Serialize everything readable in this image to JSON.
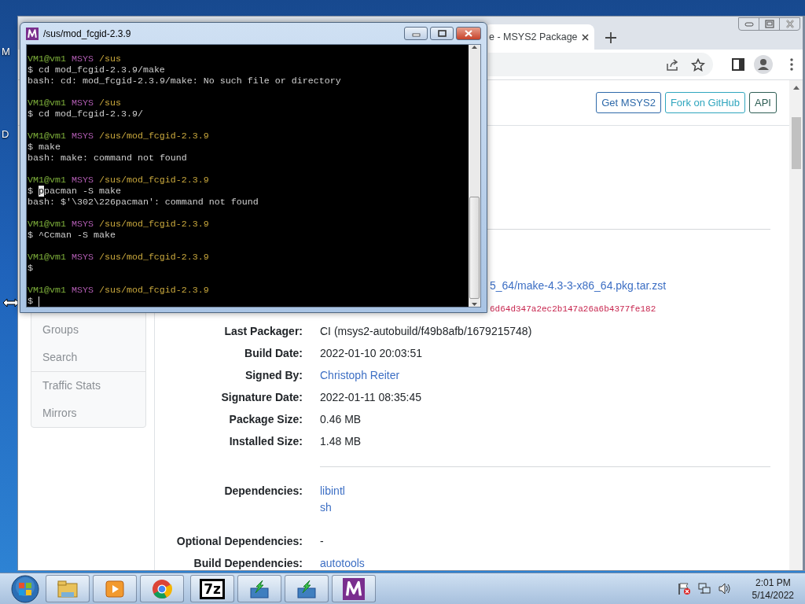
{
  "desktop": {
    "icon_labels": [
      "M",
      "D"
    ]
  },
  "terminal": {
    "title": "/sus/mod_fcgid-2.3.9",
    "lines": [
      {
        "kind": "prompt",
        "user": "VM1@vm1",
        "shell": "MSYS",
        "path": "/sus"
      },
      {
        "kind": "command",
        "sigil": "$",
        "text": "cd mod_fcgid-2.3.9/make"
      },
      {
        "kind": "output",
        "text": "bash: cd: mod_fcgid-2.3.9/make: No such file or directory"
      },
      {
        "kind": "blank"
      },
      {
        "kind": "prompt",
        "user": "VM1@vm1",
        "shell": "MSYS",
        "path": "/sus"
      },
      {
        "kind": "command",
        "sigil": "$",
        "text": "cd mod_fcgid-2.3.9/"
      },
      {
        "kind": "blank"
      },
      {
        "kind": "prompt",
        "user": "VM1@vm1",
        "shell": "MSYS",
        "path": "/sus/mod_fcgid-2.3.9"
      },
      {
        "kind": "command",
        "sigil": "$",
        "text": "make"
      },
      {
        "kind": "output",
        "text": "bash: make: command not found"
      },
      {
        "kind": "blank"
      },
      {
        "kind": "prompt",
        "user": "VM1@vm1",
        "shell": "MSYS",
        "path": "/sus/mod_fcgid-2.3.9"
      },
      {
        "kind": "command",
        "sigil": "$",
        "marked": "p",
        "text": "pacman -S make"
      },
      {
        "kind": "output",
        "text": "bash: $'\\302\\226pacman': command not found"
      },
      {
        "kind": "blank"
      },
      {
        "kind": "prompt",
        "user": "VM1@vm1",
        "shell": "MSYS",
        "path": "/sus/mod_fcgid-2.3.9"
      },
      {
        "kind": "command",
        "sigil": "$",
        "text": "^Ccman -S make"
      },
      {
        "kind": "blank"
      },
      {
        "kind": "prompt",
        "user": "VM1@vm1",
        "shell": "MSYS",
        "path": "/sus/mod_fcgid-2.3.9"
      },
      {
        "kind": "command",
        "sigil": "$"
      },
      {
        "kind": "blank"
      },
      {
        "kind": "prompt",
        "user": "VM1@vm1",
        "shell": "MSYS",
        "path": "/sus/mod_fcgid-2.3.9"
      },
      {
        "kind": "command",
        "sigil": "$",
        "cursor": true
      }
    ]
  },
  "browser": {
    "tab": {
      "title": "e - MSYS2 Package"
    },
    "header_buttons": [
      {
        "label": "Get MSYS2",
        "kind": "primary"
      },
      {
        "label": "Fork on GitHub",
        "kind": "info"
      },
      {
        "label": "API",
        "kind": "secondary"
      }
    ],
    "sidebar": {
      "groups": [
        {
          "items": [
            "Groups",
            "Search"
          ]
        },
        {
          "items": [
            "Traffic Stats",
            "Mirrors"
          ]
        }
      ]
    },
    "details": [
      {
        "kind": "separator"
      },
      {
        "kind": "link",
        "value": "5_64/make-4.3-3-x86_64.pkg.tar.zst"
      },
      {
        "kind": "hash",
        "value": "6d64d347a2ec2b147a26a6b4377fe182"
      },
      {
        "kind": "text",
        "label": "Last Packager:",
        "value": "CI (msys2-autobuild/f49b8afb/1679215748)"
      },
      {
        "kind": "text",
        "label": "Build Date:",
        "value": "2022-01-10 20:03:51"
      },
      {
        "kind": "link",
        "label": "Signed By:",
        "value": "Christoph Reiter"
      },
      {
        "kind": "text",
        "label": "Signature Date:",
        "value": "2022-01-11 08:35:45"
      },
      {
        "kind": "text",
        "label": "Package Size:",
        "value": "0.46 MB"
      },
      {
        "kind": "text",
        "label": "Installed Size:",
        "value": "1.48 MB"
      },
      {
        "kind": "separator"
      },
      {
        "kind": "links",
        "label": "Dependencies:",
        "values": [
          "libintl",
          "sh"
        ]
      },
      {
        "kind": "text",
        "label": "Optional Dependencies:",
        "value": "-"
      },
      {
        "kind": "link",
        "label": "Build Dependencies:",
        "value": "autotools"
      }
    ]
  },
  "taskbar": {
    "apps": [
      {
        "kind": "explorer"
      },
      {
        "kind": "media"
      },
      {
        "kind": "browser"
      },
      {
        "kind": "archiver",
        "glyph": "7z"
      },
      {
        "kind": "installer"
      },
      {
        "kind": "installer"
      },
      {
        "kind": "msys"
      }
    ],
    "clock": {
      "time": "2:01 PM",
      "date": "5/14/2022"
    }
  }
}
